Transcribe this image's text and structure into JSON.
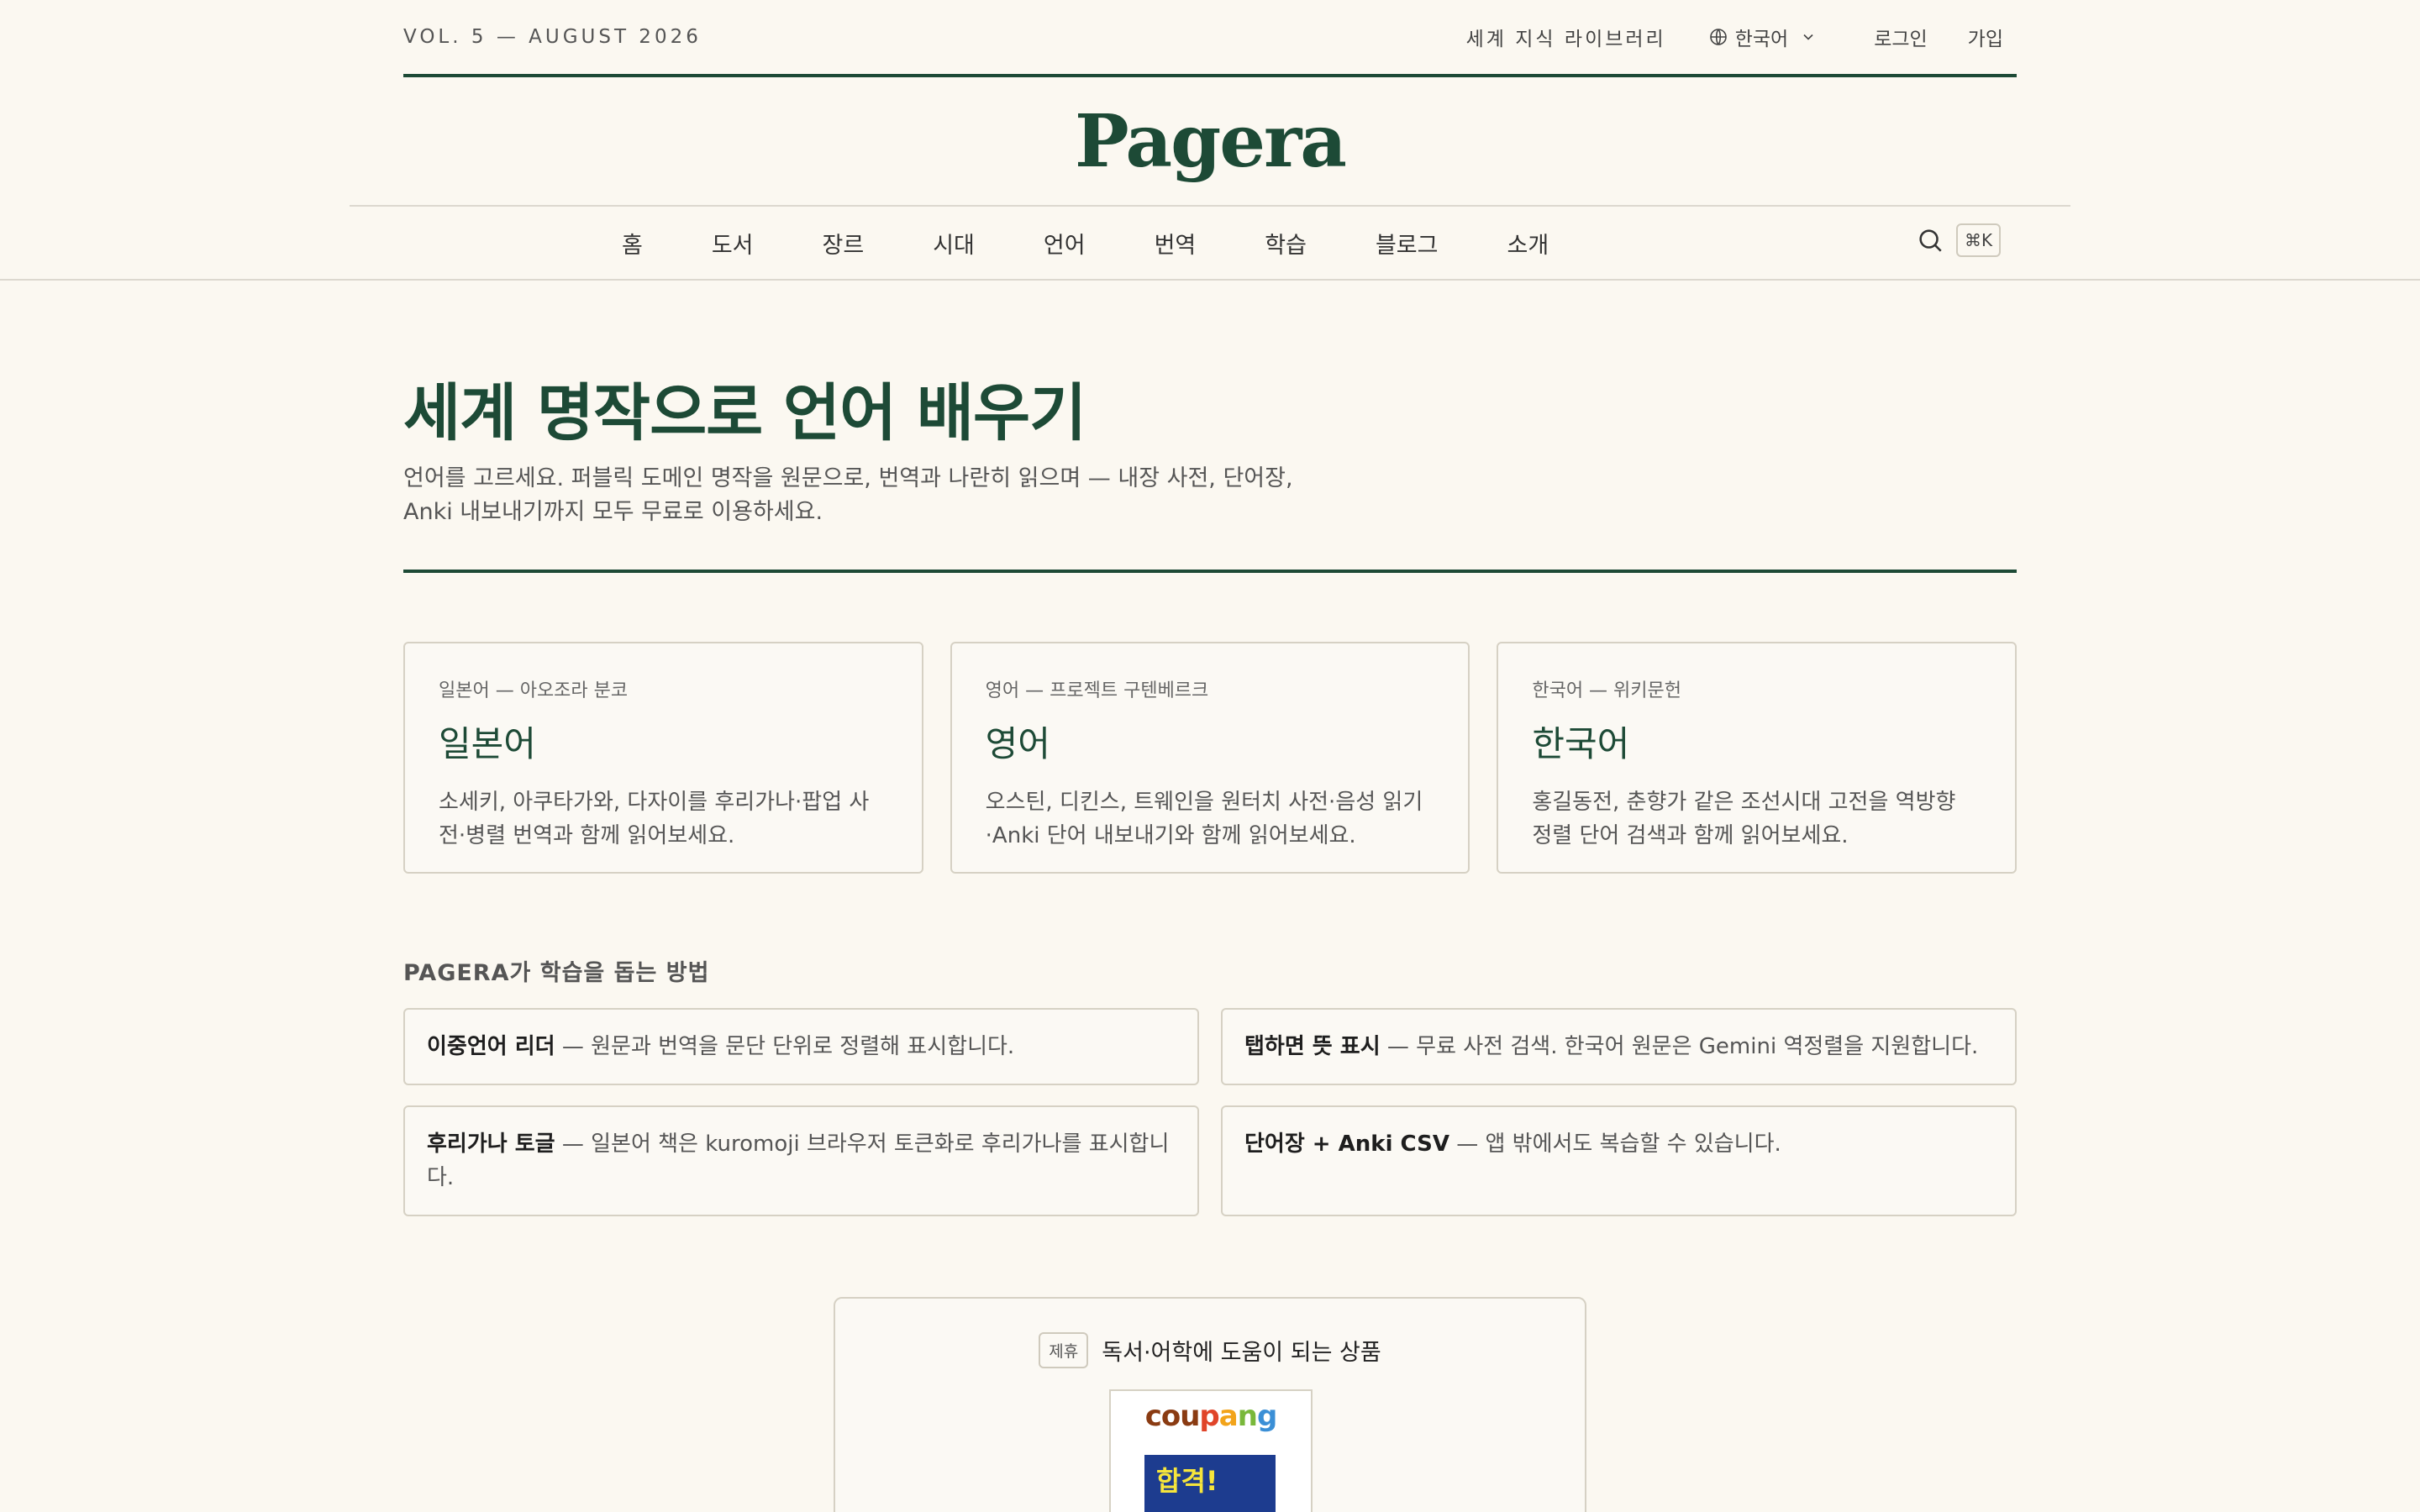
{
  "topbar": {
    "volume": "VOL. 5 — AUGUST 2026",
    "library": "세계 지식 라이브러리",
    "language": "한국어",
    "login": "로그인",
    "signup": "가입"
  },
  "brand": {
    "logo": "Pagera"
  },
  "nav": {
    "items": [
      "홈",
      "도서",
      "장르",
      "시대",
      "언어",
      "번역",
      "학습",
      "블로그",
      "소개"
    ],
    "shortcut": "⌘K"
  },
  "hero": {
    "title": "세계 명작으로 언어 배우기",
    "subtitle": "언어를 고르세요. 퍼블릭 도메인 명작을 원문으로, 번역과 나란히 읽으며 — 내장 사전, 단어장, Anki 내보내기까지 모두 무료로 이용하세요."
  },
  "languages": [
    {
      "kicker": "일본어 — 아오조라 분코",
      "title": "일본어",
      "desc": "소세키, 아쿠타가와, 다자이를 후리가나·팝업 사전·병렬 번역과 함께 읽어보세요."
    },
    {
      "kicker": "영어 — 프로젝트 구텐베르크",
      "title": "영어",
      "desc": "오스틴, 디킨스, 트웨인을 원터치 사전·음성 읽기·Anki 단어 내보내기와 함께 읽어보세요."
    },
    {
      "kicker": "한국어 — 위키문헌",
      "title": "한국어",
      "desc": "홍길동전, 춘향가 같은 조선시대 고전을 역방향 정렬 단어 검색과 함께 읽어보세요."
    }
  ],
  "features": {
    "heading": "PAGERA가 학습을 돕는 방법",
    "items": [
      {
        "title": "이중언어 리더",
        "desc": " — 원문과 번역을 문단 단위로 정렬해 표시합니다."
      },
      {
        "title": "탭하면 뜻 표시",
        "desc": " — 무료 사전 검색. 한국어 원문은 Gemini 역정렬을 지원합니다."
      },
      {
        "title": "후리가나 토글",
        "desc": " — 일본어 책은 kuromoji 브라우저 토큰화로 후리가나를 표시합니다."
      },
      {
        "title": "단어장 + Anki CSV",
        "desc": " — 앱 밖에서도 복습할 수 있습니다."
      }
    ]
  },
  "affiliate": {
    "badge": "제휴",
    "title": "독서·어학에 도움이 되는 상품",
    "store_parts": [
      "cou",
      "p",
      "a",
      "n",
      "g"
    ],
    "product_text": "합격!"
  },
  "icons": {
    "globe": "globe-icon",
    "chevron": "chevron-down-icon",
    "search": "search-icon"
  },
  "colors": {
    "brand": "#1d4a36",
    "background": "#fbf8f1",
    "border": "#d6d1c4"
  }
}
